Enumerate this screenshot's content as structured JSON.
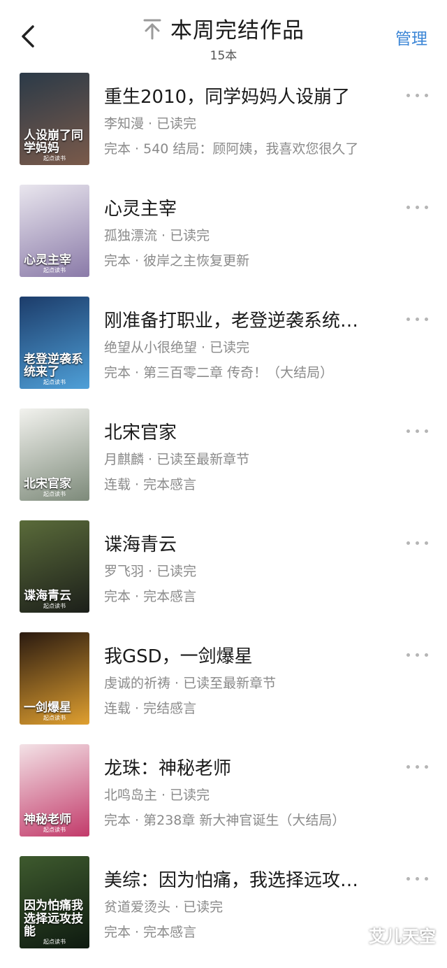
{
  "header": {
    "title": "本周完结作品",
    "count": "15本",
    "manage_label": "管理",
    "back_icon": "chevron-left-icon",
    "pin_icon": "pin-top-icon"
  },
  "colors": {
    "accent": "#3c86d6",
    "meta": "#8a8a8a"
  },
  "books": [
    {
      "title": "重生2010，同学妈妈人设崩了",
      "meta1": "李知漫 · 已读完",
      "meta2": "完本 · 540 结局：顾阿姨，我喜欢您很久了",
      "cover_text": "人设崩了同学妈妈",
      "cover_colors": [
        "#2b3a48",
        "#7a5a4a"
      ]
    },
    {
      "title": "心灵主宰",
      "meta1": "孤独漂流 · 已读完",
      "meta2": "完本 · 彼岸之主恢复更新",
      "cover_text": "心灵主宰",
      "cover_colors": [
        "#e9e6ee",
        "#8a7aa8"
      ]
    },
    {
      "title": "刚准备打职业，老登逆袭系统…",
      "meta1": "绝望从小很绝望 · 已读完",
      "meta2": "完本 · 第三百零二章 传奇！（大结局）",
      "cover_text": "老登逆袭系统来了",
      "cover_colors": [
        "#1c3c6a",
        "#4fa0d8"
      ]
    },
    {
      "title": "北宋官家",
      "meta1": "月麒麟 · 已读至最新章节",
      "meta2": "连载 · 完本感言",
      "cover_text": "北宋官家",
      "cover_colors": [
        "#f2f2ee",
        "#7d8a7a"
      ]
    },
    {
      "title": "谍海青云",
      "meta1": "罗飞羽 · 已读完",
      "meta2": "完本 · 完本感言",
      "cover_text": "谍海青云",
      "cover_colors": [
        "#5a6b3a",
        "#1c1f1a"
      ]
    },
    {
      "title": "我GSD，一剑爆星",
      "meta1": "虔诚的祈祷 · 已读至最新章节",
      "meta2": "连载 · 完结感言",
      "cover_text": "一剑爆星",
      "cover_colors": [
        "#2a1a10",
        "#e0a030"
      ]
    },
    {
      "title": "龙珠：神秘老师",
      "meta1": "北鸣岛主 · 已读完",
      "meta2": "完本 · 第238章 新大神官诞生（大结局）",
      "cover_text": "神秘老师",
      "cover_colors": [
        "#f3e2e6",
        "#c23a6a"
      ]
    },
    {
      "title": "美综：因为怕痛，我选择远攻…",
      "meta1": "贫道爱烫头 · 已读完",
      "meta2": "完本 · 完本感言",
      "cover_text": "因为怕痛我选择远攻技能",
      "cover_colors": [
        "#3e5a2e",
        "#0e1a10"
      ]
    }
  ],
  "cover_brand": "起点读书",
  "watermark": "艾儿天空"
}
